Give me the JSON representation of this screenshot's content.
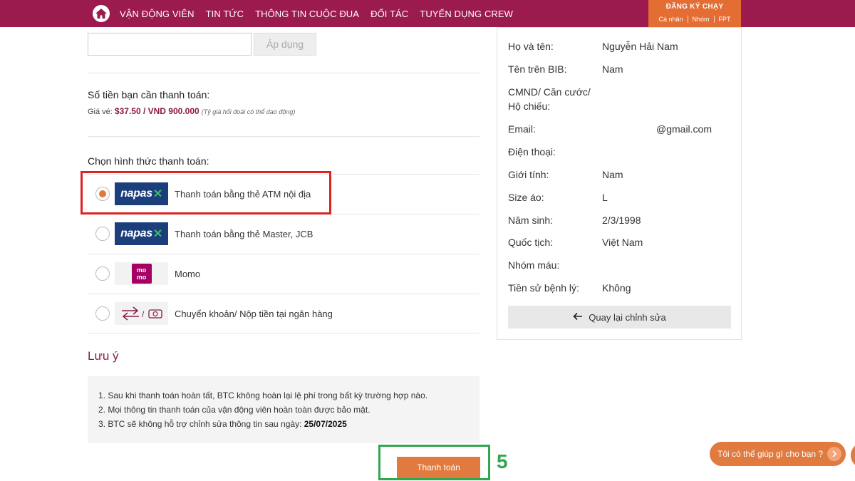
{
  "nav": {
    "items": [
      "VẬN ĐỘNG VIÊN",
      "TIN TỨC",
      "THÔNG TIN CUỘC ĐUA",
      "ĐỐI TÁC",
      "TUYỂN DỤNG CREW"
    ],
    "register": {
      "title": "ĐĂNG KÝ CHẠY",
      "options": [
        "Cá nhân",
        "Nhóm",
        "FPT"
      ]
    }
  },
  "coupon": {
    "value": "",
    "apply_label": "Áp dụng"
  },
  "payment_amount": {
    "title": "Số tiền bạn cần thanh toán:",
    "price_prefix": "Giá vé:",
    "price": "$37.50 / VND 900.000",
    "note": "(Tỷ giá hối đoái có thể dao động)"
  },
  "payment_methods": {
    "title": "Chọn hình thức thanh toán:",
    "options": [
      {
        "label": "Thanh toán bằng thẻ ATM nội địa",
        "logo": "napas",
        "selected": true
      },
      {
        "label": "Thanh toán bằng thẻ Master, JCB",
        "logo": "napas",
        "selected": false
      },
      {
        "label": "Momo",
        "logo": "momo",
        "selected": false
      },
      {
        "label": "Chuyển khoản/ Nộp tiền tại ngân hàng",
        "logo": "bank-transfer",
        "selected": false
      }
    ],
    "logo_text": {
      "napas": "napas",
      "momo": "mo mo"
    }
  },
  "notes": {
    "title": "Lưu ý",
    "items": [
      "1. Sau khi thanh toán hoàn tất, BTC không hoàn lại lệ phí trong bất kỳ trường hợp nào.",
      "2. Mọi thông tin thanh toán của vận động viên hoàn toàn được bảo mật."
    ],
    "item3_prefix": "3. BTC sẽ không hỗ trợ chỉnh sửa thông tin sau ngày:",
    "item3_date": "25/07/2025"
  },
  "pay_button": "Thanh toán",
  "step_number": "5",
  "runner_info": {
    "rows": [
      {
        "label": "Họ và tên:",
        "value": "Nguyễn Hải Nam"
      },
      {
        "label": "Tên trên BIB:",
        "value": "Nam"
      },
      {
        "label": "CMND/ Căn cước/ Hộ chiếu:",
        "value": ""
      },
      {
        "label": "Email:",
        "value": "@gmail.com"
      },
      {
        "label": "Điện thoại:",
        "value": ""
      },
      {
        "label": "Giới tính:",
        "value": "Nam"
      },
      {
        "label": "Size áo:",
        "value": "L"
      },
      {
        "label": "Năm sinh:",
        "value": "2/3/1998"
      },
      {
        "label": "Quốc tịch:",
        "value": "Việt Nam"
      },
      {
        "label": "Nhóm máu:",
        "value": ""
      },
      {
        "label": "Tiền sử bệnh lý:",
        "value": "Không"
      }
    ],
    "back_button": "Quay lại chỉnh sửa"
  },
  "chat": {
    "prompt": "Tôi có thể giúp gì cho bạn ?"
  },
  "colors": {
    "brand": "#9b1b4e",
    "accent": "#e07a3f",
    "highlight_red": "#dd2222",
    "highlight_green": "#2fa84f"
  },
  "icons": [
    "home-icon",
    "radio-icon",
    "arrow-left-icon",
    "chevron-right-icon"
  ]
}
